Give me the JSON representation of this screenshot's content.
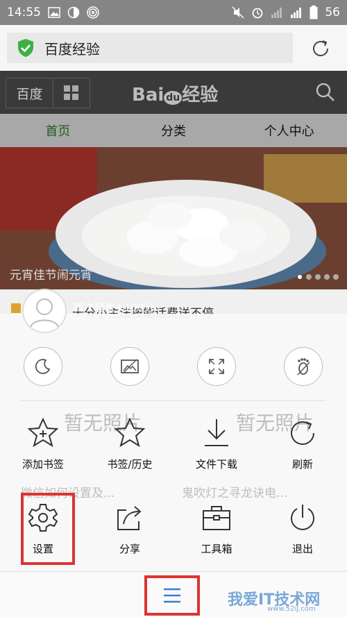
{
  "status_bar": {
    "time": "14:55",
    "battery": "56"
  },
  "address_bar": {
    "title": "百度经验"
  },
  "site_header": {
    "left_label": "百度",
    "logo_text": "Bai经验",
    "logo_du": "du"
  },
  "tabs": [
    {
      "label": "首页"
    },
    {
      "label": "分类"
    },
    {
      "label": "个人中心"
    }
  ],
  "banner": {
    "caption": "元宵佳节闹元宵"
  },
  "background_text": {
    "line1": "十分小主法按能话费送不停",
    "photo_left": "暂无照片",
    "photo_right": "暂无照片",
    "row_left": "微信如何设置及...",
    "row_right": "鬼吹灯之寻龙诀电..."
  },
  "menu": {
    "login_text": "首次登录+100分",
    "row1": [
      {
        "label": "添加书签",
        "icon": "add-bookmark-icon"
      },
      {
        "label": "书签/历史",
        "icon": "star-icon"
      },
      {
        "label": "文件下载",
        "icon": "download-icon"
      },
      {
        "label": "刷新",
        "icon": "refresh-icon"
      }
    ],
    "row2": [
      {
        "label": "设置",
        "icon": "gear-icon"
      },
      {
        "label": "分享",
        "icon": "share-icon"
      },
      {
        "label": "工具箱",
        "icon": "toolbox-icon"
      },
      {
        "label": "退出",
        "icon": "power-icon"
      }
    ]
  },
  "watermark": {
    "text": "我爱IT技术网",
    "url": "www.52ij.com"
  },
  "colors": {
    "highlight": "#dd3333",
    "active_tab": "#1d5e1d"
  }
}
